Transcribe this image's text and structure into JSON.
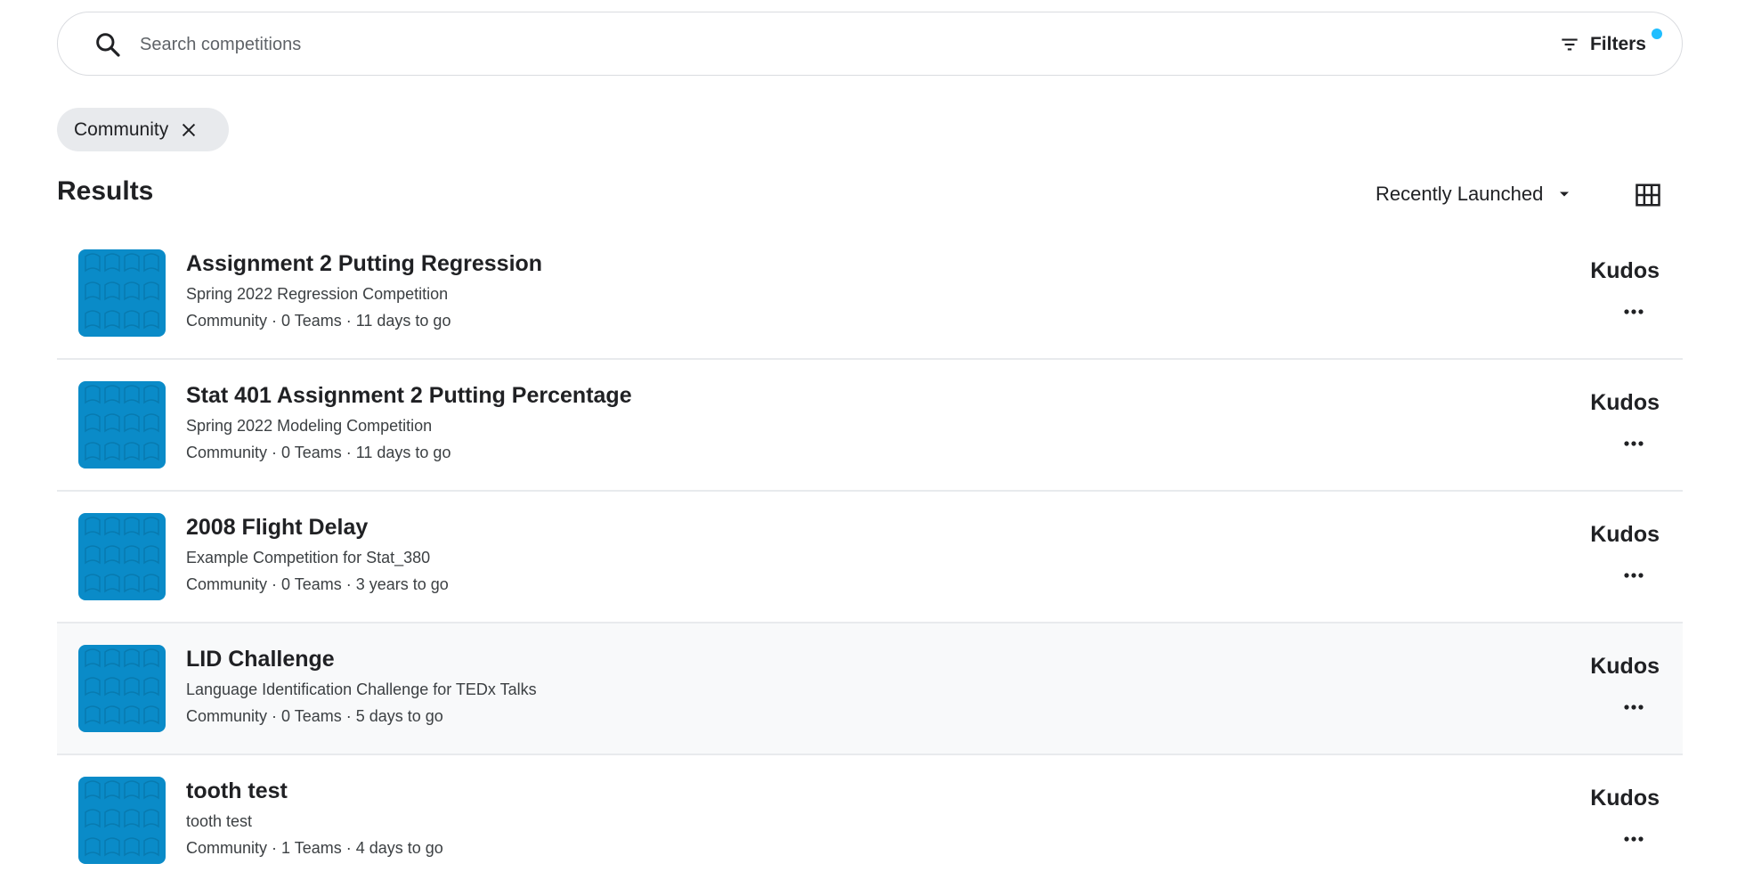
{
  "search": {
    "placeholder": "Search competitions",
    "filters_label": "Filters",
    "filters_dot_color": "#20beff"
  },
  "active_filters": [
    {
      "label": "Community"
    }
  ],
  "results": {
    "title": "Results",
    "sort_label": "Recently Launched"
  },
  "colors": {
    "thumbnail": "#0a8bc8",
    "highlight_row": "#f8f9fa"
  },
  "competitions": [
    {
      "title": "Assignment 2 Putting Regression",
      "subtitle": "Spring 2022 Regression Competition",
      "meta": "Community · 0 Teams · 11 days to go",
      "prize": "Kudos"
    },
    {
      "title": "Stat 401 Assignment 2 Putting Percentage",
      "subtitle": "Spring 2022 Modeling Competition",
      "meta": "Community · 0 Teams · 11 days to go",
      "prize": "Kudos"
    },
    {
      "title": "2008 Flight Delay",
      "subtitle": "Example Competition for Stat_380",
      "meta": "Community · 0 Teams · 3 years to go",
      "prize": "Kudos"
    },
    {
      "title": "LID Challenge",
      "subtitle": "Language Identification Challenge for TEDx Talks",
      "meta": "Community · 0 Teams · 5 days to go",
      "prize": "Kudos"
    },
    {
      "title": "tooth test",
      "subtitle": "tooth test",
      "meta": "Community · 1 Teams · 4 days to go",
      "prize": "Kudos"
    }
  ]
}
